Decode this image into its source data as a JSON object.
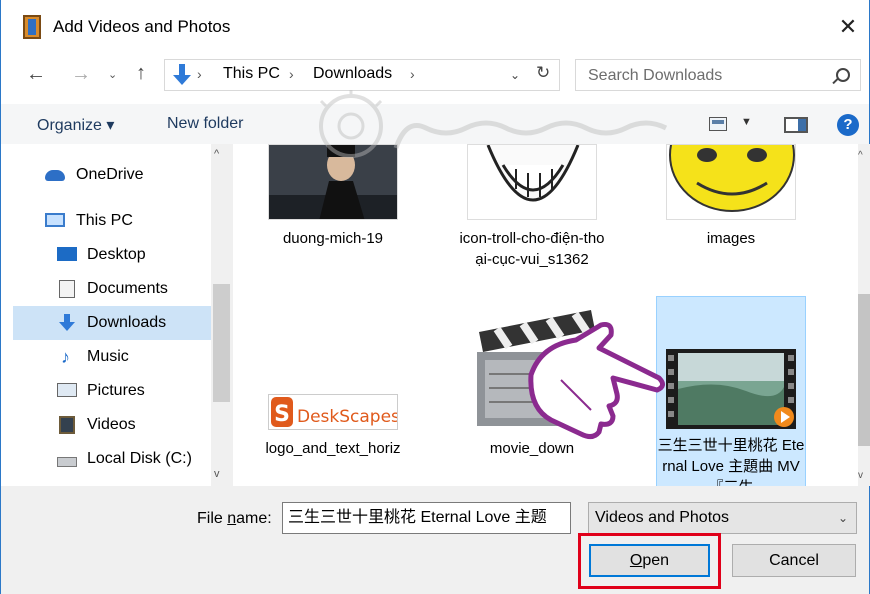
{
  "window": {
    "title": "Add Videos and Photos",
    "close_glyph": "✕"
  },
  "nav": {
    "back": "←",
    "forward": "→",
    "recent": "⌄",
    "up": "↑"
  },
  "address": {
    "crumbs": [
      "This PC",
      "Downloads"
    ],
    "sep": "›",
    "drop": "⌄",
    "refresh": "↻"
  },
  "search": {
    "placeholder": "Search Downloads"
  },
  "toolbar": {
    "organize": "Organize ▾",
    "new_folder": "New folder",
    "view_drop": "▼",
    "help": "?"
  },
  "sidebar": {
    "items": [
      {
        "label": "OneDrive",
        "icon": "cloud-icon"
      },
      {
        "label": "This PC",
        "icon": "computer-icon"
      },
      {
        "label": "Desktop",
        "icon": "desktop-icon"
      },
      {
        "label": "Documents",
        "icon": "documents-icon"
      },
      {
        "label": "Downloads",
        "icon": "downloads-icon",
        "selected": true
      },
      {
        "label": "Music",
        "icon": "music-icon"
      },
      {
        "label": "Pictures",
        "icon": "pictures-icon"
      },
      {
        "label": "Videos",
        "icon": "videos-icon"
      },
      {
        "label": "Local Disk (C:)",
        "icon": "disk-icon"
      }
    ],
    "music_glyph": "♪",
    "scroll_up": "^",
    "scroll_down": "v"
  },
  "files": {
    "items": [
      {
        "name": "duong-mich-19",
        "icon": "photo-thumbnail"
      },
      {
        "name": "icon-troll-cho-điện-thoại-cục-vui_s1362",
        "icon": "troll-face-thumbnail"
      },
      {
        "name": "images",
        "icon": "yellow-face-thumbnail"
      },
      {
        "name": "logo_and_text_horiz",
        "logo_text": "DeskScapes",
        "icon": "deskscapes-logo-thumbnail"
      },
      {
        "name": "movie_down",
        "icon": "clapperboard-thumbnail"
      },
      {
        "name": "三生三世十里桃花 Eternal Love 主題曲 MV『三生",
        "icon": "video-thumbnail",
        "selected": true
      }
    ],
    "scroll_up": "^",
    "scroll_down": "v"
  },
  "bottom": {
    "file_name_label_pre": "File ",
    "file_name_label_u": "n",
    "file_name_label_post": "ame:",
    "file_name_value": "三生三世十里桃花 Eternal Love 主题",
    "file_type": "Videos and Photos",
    "open_u": "O",
    "open_rest": "pen",
    "cancel": "Cancel",
    "drop": "⌄"
  },
  "colors": {
    "accent": "#0078d7",
    "highlight_box": "#e0001a",
    "selection": "#cde3f7"
  }
}
